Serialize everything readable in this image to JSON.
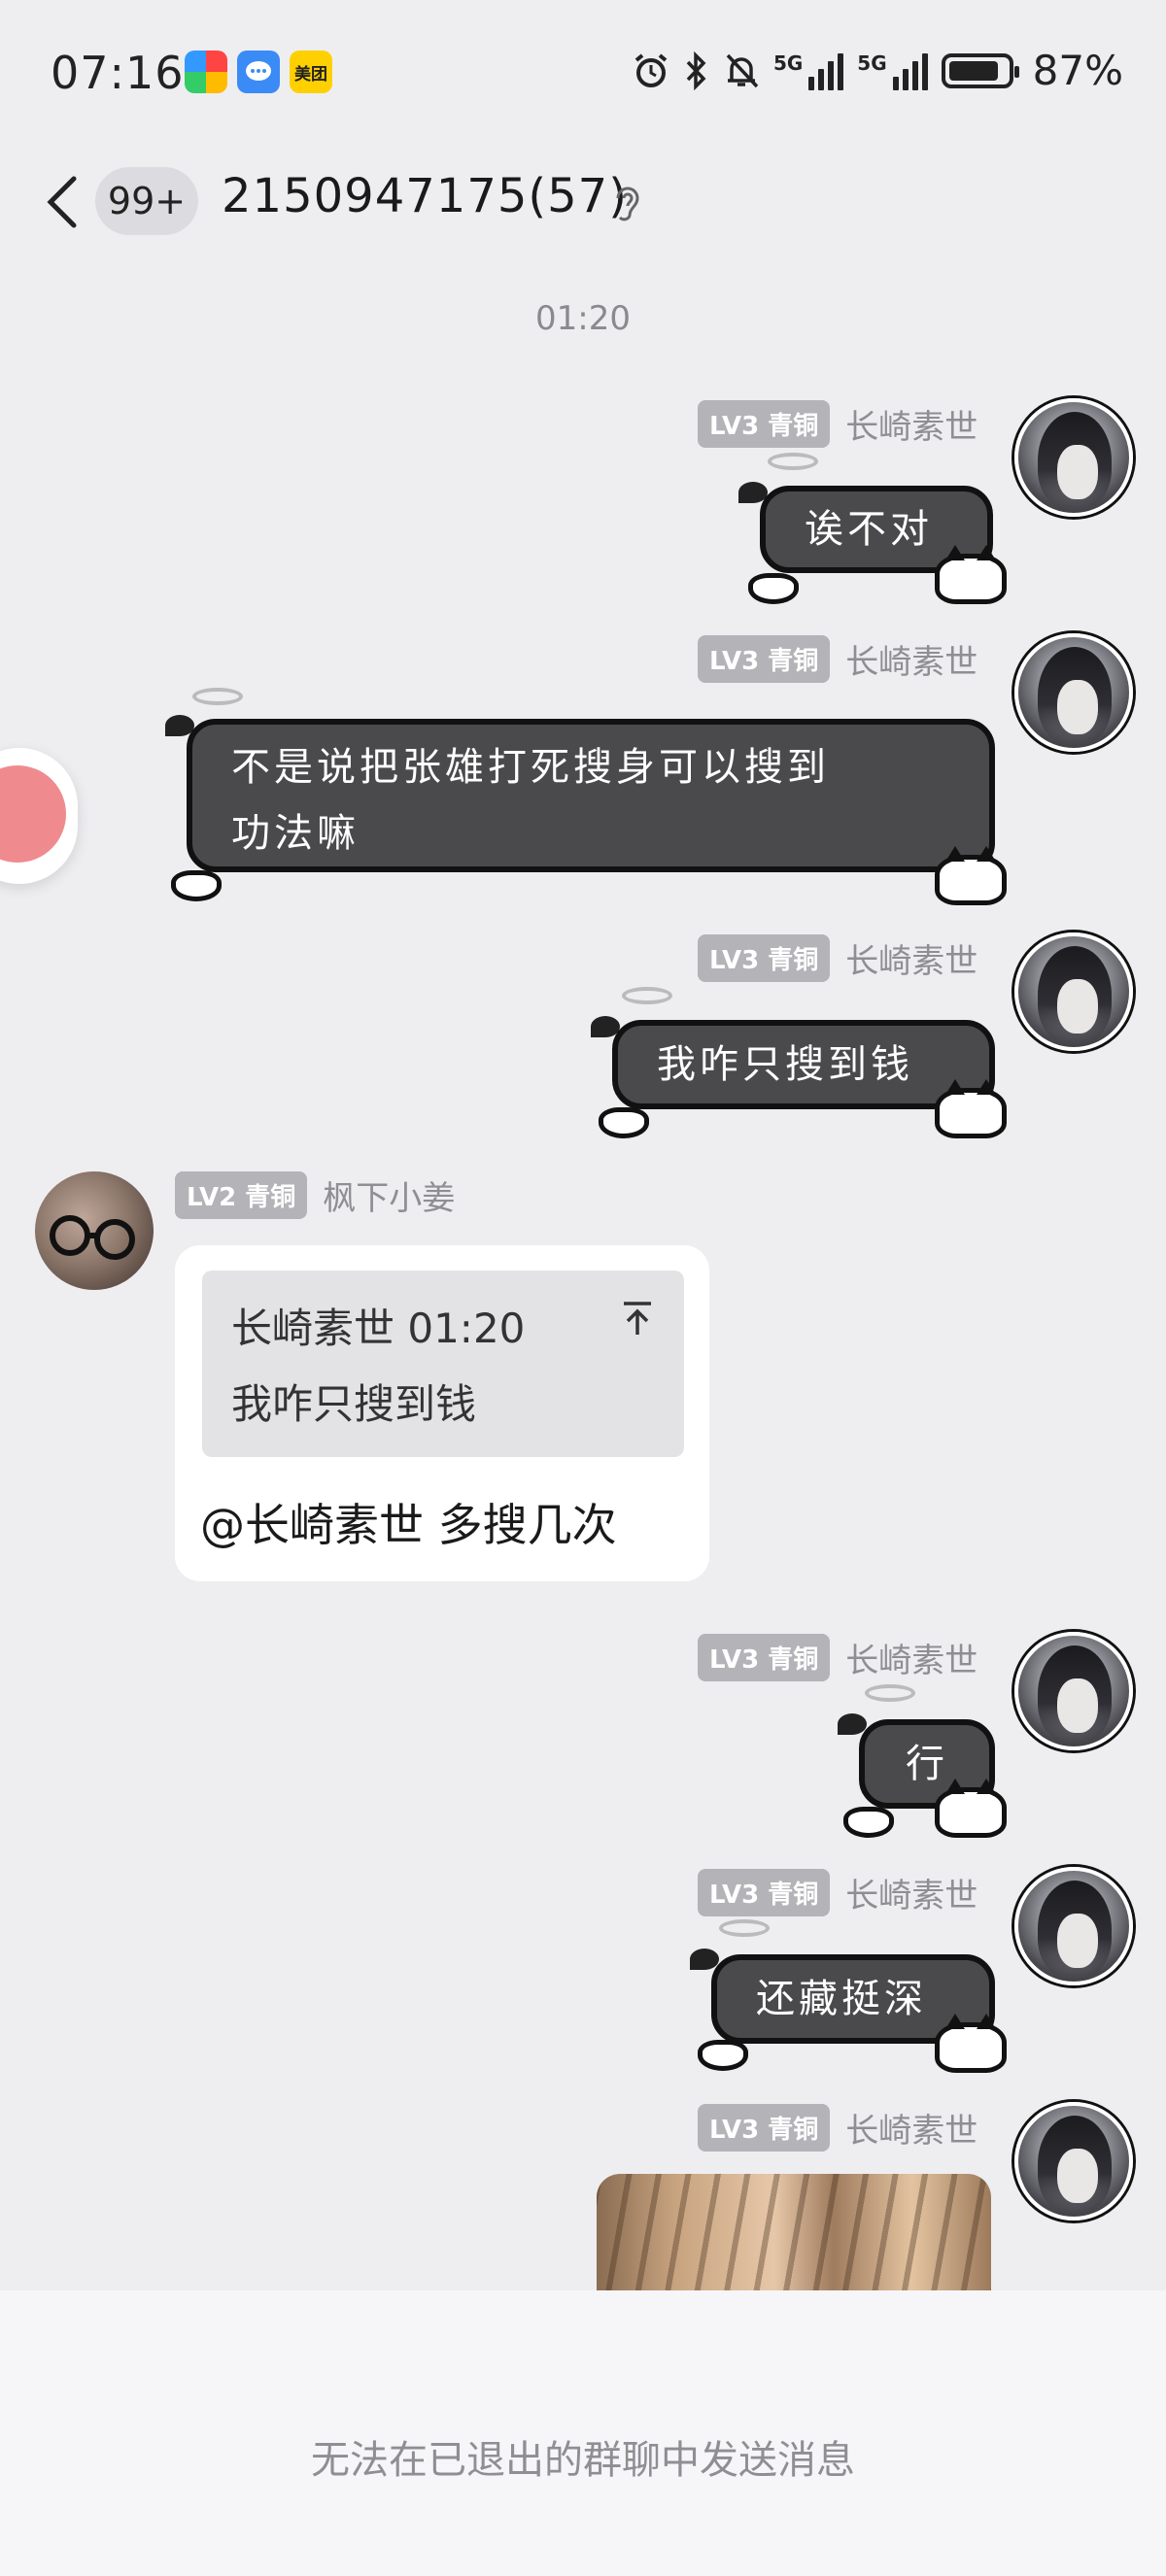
{
  "status_bar": {
    "time": "07:16",
    "app_icons": [
      "photos-app-icon",
      "messages-app-icon",
      "meituan-app-icon"
    ],
    "meituan_label": "美团",
    "network_1": "5G",
    "network_2": "5G",
    "battery": "87%",
    "battery_level": 0.87
  },
  "header": {
    "unread_badge": "99+",
    "title": "2150947175(57)"
  },
  "timestamp": "01:20",
  "me": {
    "level": "LV3 青铜",
    "nickname": "长崎素世"
  },
  "other": {
    "level": "LV2 青铜",
    "nickname": "枫下小姜"
  },
  "messages": [
    {
      "text": "诶不对"
    },
    {
      "line1": "不是说把张雄打死搜身可以搜到",
      "line2": "功法嘛"
    },
    {
      "text": "我咋只搜到钱"
    },
    {
      "quote_author_time": "长崎素世 01:20",
      "quote_text": "我咋只搜到钱",
      "text": "@长崎素世 多搜几次"
    },
    {
      "text": "行"
    },
    {
      "text": "还藏挺深"
    }
  ],
  "footer": {
    "notice": "无法在已退出的群聊中发送消息"
  },
  "colors": {
    "bubble_bg": "#4a4a4c",
    "badge": "#b3b3b8",
    "background": "#eeeef1"
  }
}
